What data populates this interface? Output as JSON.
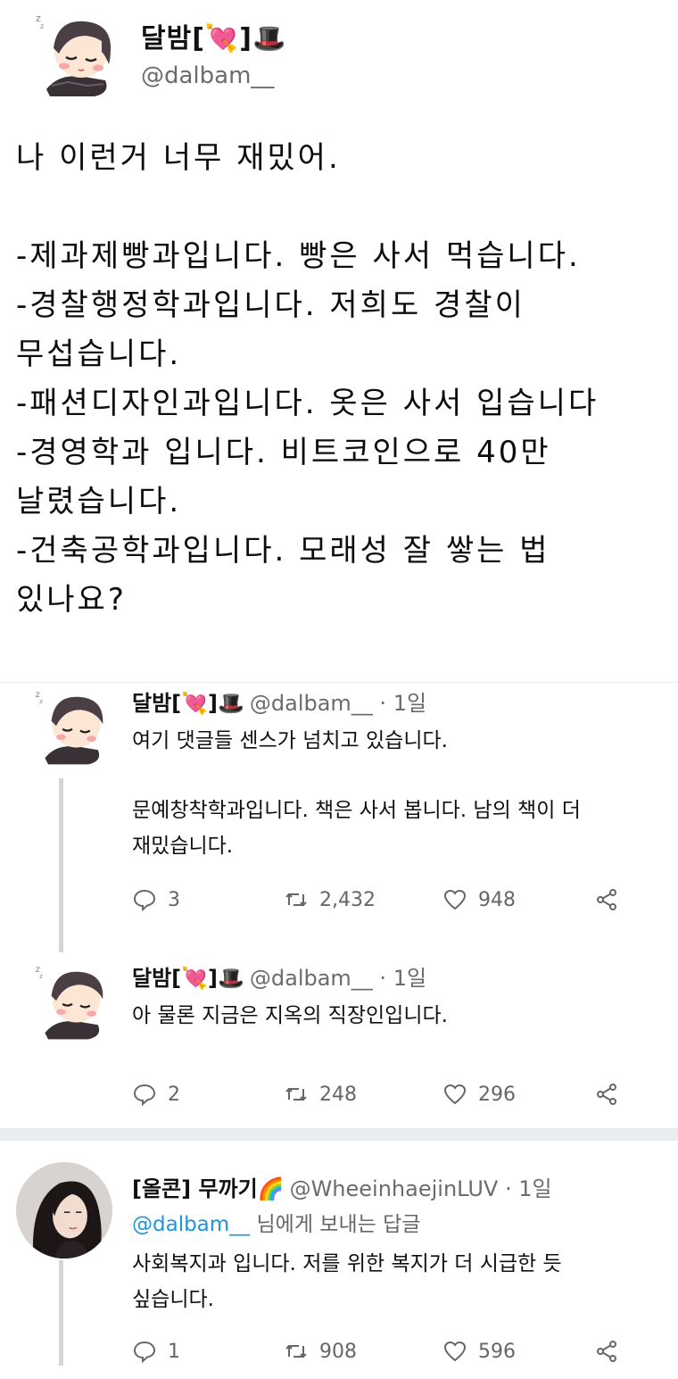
{
  "main_tweet": {
    "name": "달밤[💘]🎩",
    "handle": "@dalbam__",
    "lines": [
      "나 이런거 너무 재밌어.",
      "",
      "-제과제빵과입니다. 빵은 사서 먹습니다.",
      "-경찰행정학과입니다. 저희도 경찰이",
      "무섭습니다.",
      "-패션디자인과입니다. 옷은 사서 입습니다",
      "-경영학과 입니다. 비트코인으로 40만",
      "날렸습니다.",
      "-건축공학과입니다.  모래성 잘 쌓는 법",
      "있나요?"
    ]
  },
  "replies": [
    {
      "name": "달밤[💘]🎩",
      "handle": "@dalbam__ · 1일",
      "text1": "여기 댓글들 센스가 넘치고 있습니다.",
      "text2": "문예창착학과입니다. 책은 사서 봅니다. 남의 책이 더",
      "text3": "재밌습니다.",
      "replies": "3",
      "retweets": "2,432",
      "likes": "948"
    },
    {
      "name": "달밤[💘]🎩",
      "handle": "@dalbam__ · 1일",
      "text1": "아 물론 지금은 지옥의 직장인입니다.",
      "replies": "2",
      "retweets": "248",
      "likes": "296"
    },
    {
      "name": "[올콘] 무까기🌈",
      "handle": "@WheeinhaejinLUV · 1일",
      "mention": "@dalbam__",
      "reply_to_text": " 님에게 보내는 답글",
      "text1": "사회복지과 입니다. 저를 위한 복지가 더 시급한 듯",
      "text2": "싶습니다.",
      "replies": "1",
      "retweets": "908",
      "likes": "596"
    }
  ],
  "icons": {
    "reply": "reply-icon",
    "retweet": "retweet-icon",
    "like": "heart-icon",
    "share": "share-icon"
  },
  "colors": {
    "text": "#111111",
    "muted": "#666666",
    "mention": "#1b95e0",
    "thread_line": "#d5d5d5"
  }
}
